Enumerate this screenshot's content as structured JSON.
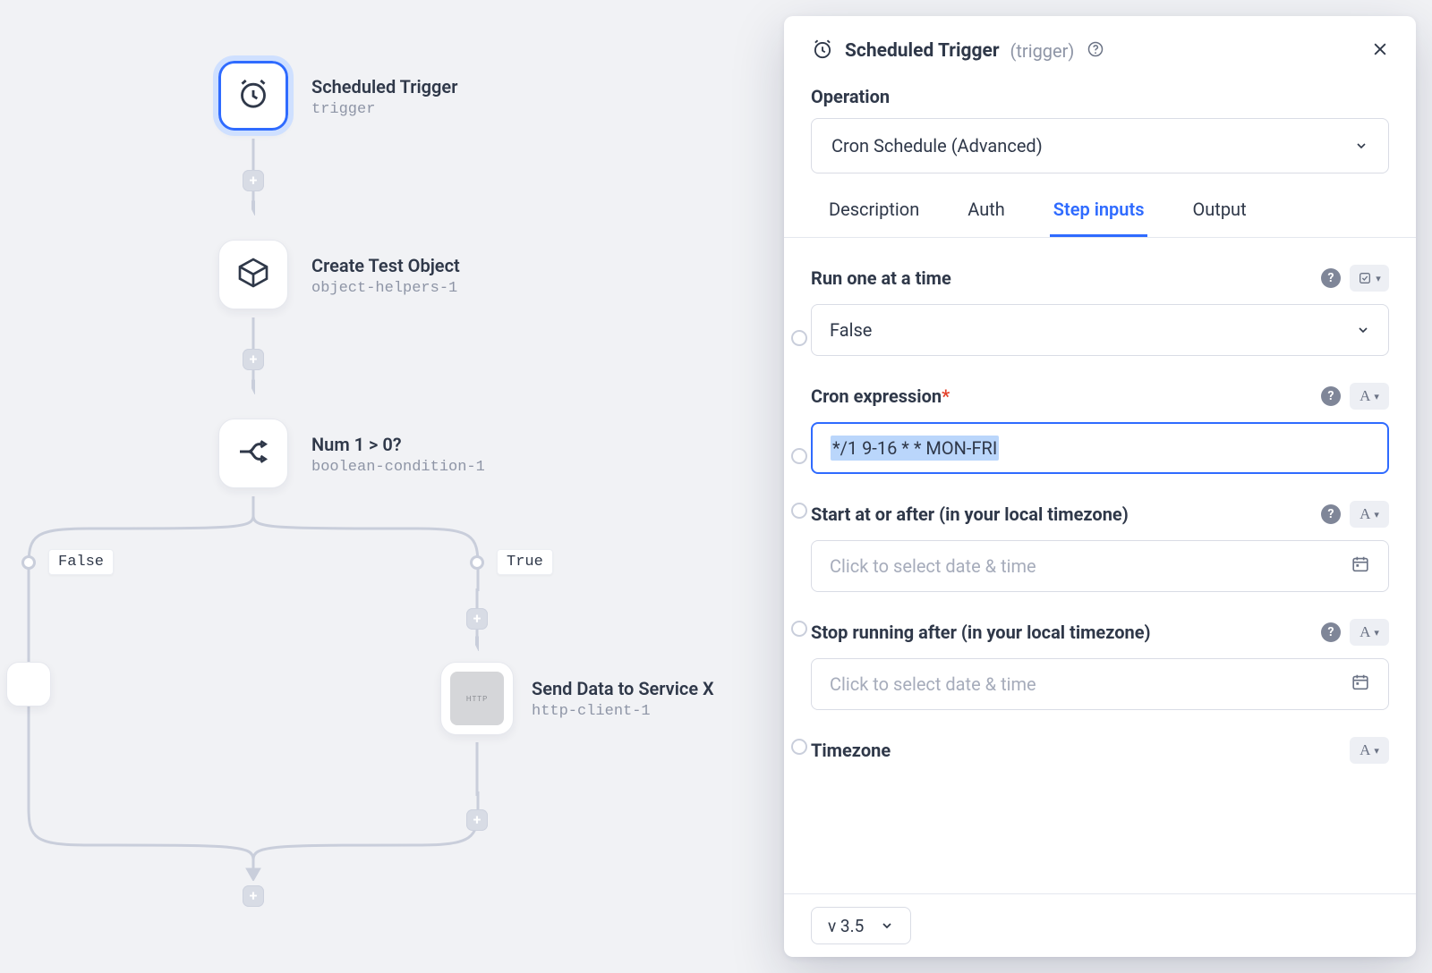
{
  "canvas": {
    "nodes": {
      "trigger": {
        "title": "Scheduled Trigger",
        "sub": "trigger"
      },
      "object": {
        "title": "Create Test Object",
        "sub": "object-helpers-1"
      },
      "cond": {
        "title": "Num 1 > 0?",
        "sub": "boolean-condition-1"
      },
      "http": {
        "title": "Send Data to Service X",
        "sub": "http-client-1"
      }
    },
    "branches": {
      "false_label": "False",
      "true_label": "True"
    }
  },
  "panel": {
    "title": "Scheduled Trigger",
    "title_tag": "(trigger)",
    "operation_label": "Operation",
    "operation_value": "Cron Schedule (Advanced)",
    "tabs": {
      "desc": "Description",
      "auth": "Auth",
      "inputs": "Step inputs",
      "output": "Output"
    },
    "fields": {
      "run_one": {
        "label": "Run one at a time",
        "value": "False"
      },
      "cron": {
        "label": "Cron expression",
        "value": "*/1 9-16 * * MON-FRI"
      },
      "start_at": {
        "label": "Start at or after (in your local timezone)",
        "placeholder": "Click to select date & time"
      },
      "stop_at": {
        "label": "Stop running after (in your local timezone)",
        "placeholder": "Click to select date & time"
      },
      "tz": {
        "label": "Timezone"
      }
    },
    "version": "v 3.5"
  }
}
